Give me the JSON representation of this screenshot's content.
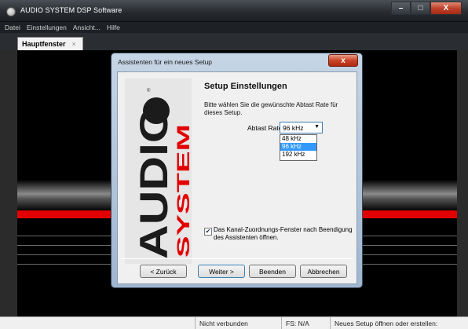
{
  "window": {
    "title": "AUDIO SYSTEM DSP Software",
    "minimize": "–",
    "maximize": "□",
    "close": "X"
  },
  "menu": [
    "Datei",
    "Einstellungen",
    "Ansicht...",
    "Hilfe"
  ],
  "tab": {
    "label": "Hauptfenster",
    "close": "×"
  },
  "dialog": {
    "title": "Assistenten für ein neues Setup",
    "close": "x",
    "heading": "Setup Einstellungen",
    "description": "Bitte wählen Sie die gewünschte Abtast Rate für dieses Setup.",
    "rate_label": "Abtast Rate",
    "rate_value": "96 kHz",
    "rate_options": [
      "48 kHz",
      "96 kHz",
      "192 kHz"
    ],
    "rate_selected_index": 1,
    "checkbox_checked": true,
    "checkbox_label": "Das Kanal-Zuordnungs-Fenster nach Beendigung des Assistenten öffnen.",
    "buttons": {
      "back": "< Zurück",
      "next": "Weiter >",
      "finish": "Beenden",
      "cancel": "Abbrechen"
    },
    "logo_text": {
      "audio": "AUDIO",
      "system": "SYSTEM",
      "registered": "®"
    }
  },
  "status": {
    "connection": "Nicht verbunden",
    "fs": "FS: N/A",
    "hint": "Neues Setup öffnen oder erstellen:"
  },
  "colors": {
    "accent_red": "#e20000",
    "selection_blue": "#3399ff"
  }
}
